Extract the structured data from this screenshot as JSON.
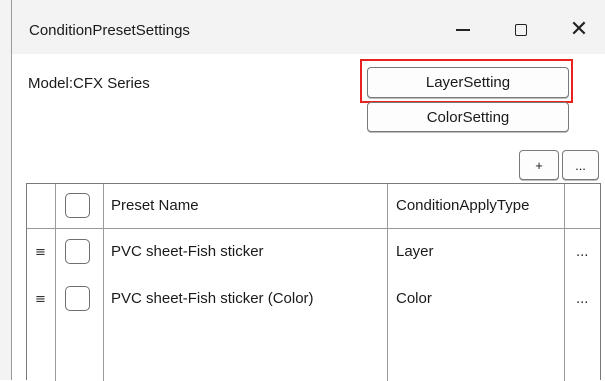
{
  "window": {
    "title": "ConditionPresetSettings",
    "minimize_glyph": "—",
    "close_glyph": "✕"
  },
  "model_label": "Model:CFX Series",
  "buttons": {
    "layer_setting": "LayerSetting",
    "color_setting": "ColorSetting",
    "add": "+",
    "more": "..."
  },
  "highlight_color": "#e8231f",
  "table": {
    "columns": [
      "Preset Name",
      "ConditionApplyType"
    ],
    "rows": [
      {
        "drag": "≡",
        "name": "PVC sheet-Fish sticker",
        "type": "Layer",
        "action": "..."
      },
      {
        "drag": "≡",
        "name": "PVC sheet-Fish sticker (Color)",
        "type": "Color",
        "action": "..."
      }
    ]
  }
}
